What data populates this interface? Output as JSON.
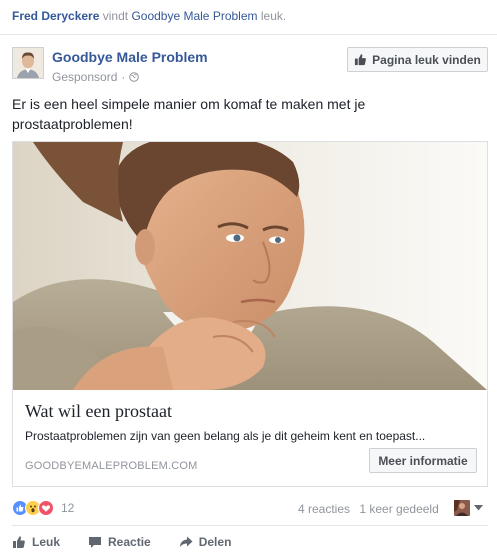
{
  "social_context": {
    "friend_name": "Fred Deryckere",
    "verb": "vindt",
    "page_name": "Goodbye Male Problem",
    "suffix": "leuk."
  },
  "post_header": {
    "page_name": "Goodbye Male Problem",
    "sponsored_label": "Gesponsord",
    "separator": "·",
    "like_page_label": "Pagina leuk vinden"
  },
  "post": {
    "text": "Er is een heel simpele manier om komaf te maken met je prostaatproblemen!"
  },
  "card": {
    "headline": "Wat wil een prostaat",
    "description": "Prostaatproblemen zijn van geen belang als je dit geheim kent en toepast...",
    "domain": "GOODBYEMALEPROBLEM.COM",
    "cta_label": "Meer informatie"
  },
  "engagement": {
    "reaction_count": "12",
    "comments": "4 reacties",
    "shares": "1 keer gedeeld"
  },
  "actions": {
    "like": "Leuk",
    "comment": "Reactie",
    "share": "Delen"
  },
  "colors": {
    "link_blue": "#365899",
    "meta_gray": "#90949c",
    "like_blue": "#5890ff",
    "love_red": "#f25268",
    "wow_yellow": "#fcd04b"
  },
  "icons": {
    "page_avatar": "man-portrait",
    "audience": "globe-icon",
    "like_page": "thumbs-up-icon",
    "reactions": [
      "like-reaction-icon",
      "wow-reaction-icon",
      "love-reaction-icon"
    ],
    "actions": [
      "thumbs-up-icon",
      "comment-icon",
      "share-arrow-icon"
    ]
  }
}
